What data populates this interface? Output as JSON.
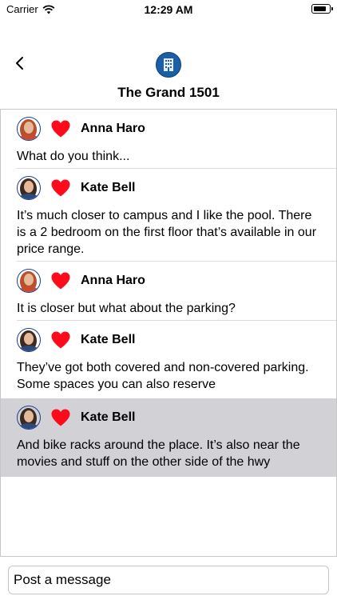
{
  "status_bar": {
    "carrier": "Carrier",
    "time": "12:29 AM",
    "battery_level": 0.85
  },
  "header": {
    "title": "The Grand 1501",
    "icon": "building-icon"
  },
  "posts": [
    {
      "author": "Anna Haro",
      "avatar_hair": "#b5512c",
      "avatar_shirt": "#c84b2e",
      "liked": true,
      "body": "What do you think...",
      "selected": false
    },
    {
      "author": "Kate Bell",
      "avatar_hair": "#3a2b22",
      "avatar_shirt": "#2c4a7a",
      "liked": true,
      "body": "It’s much closer to campus and I like the pool. There is a 2 bedroom on the first floor that’s available in our price range.",
      "selected": false
    },
    {
      "author": "Anna Haro",
      "avatar_hair": "#b5512c",
      "avatar_shirt": "#c84b2e",
      "liked": true,
      "body": "It is closer but what about the parking?",
      "selected": false
    },
    {
      "author": "Kate Bell",
      "avatar_hair": "#3a2b22",
      "avatar_shirt": "#2c4a7a",
      "liked": true,
      "body": "They’ve got both covered and non-covered parking. Some spaces you can also reserve",
      "selected": false
    },
    {
      "author": "Kate Bell",
      "avatar_hair": "#3a2b22",
      "avatar_shirt": "#2c4a7a",
      "liked": true,
      "body": "And bike racks around the place. It’s also near the movies and stuff on the other side of the hwy",
      "selected": true
    }
  ],
  "composer": {
    "placeholder": "Post a message",
    "value": ""
  },
  "colors": {
    "heart": "#ff0a1a",
    "selected_row": "#d1d1d6",
    "accent": "#1a5fa8"
  }
}
